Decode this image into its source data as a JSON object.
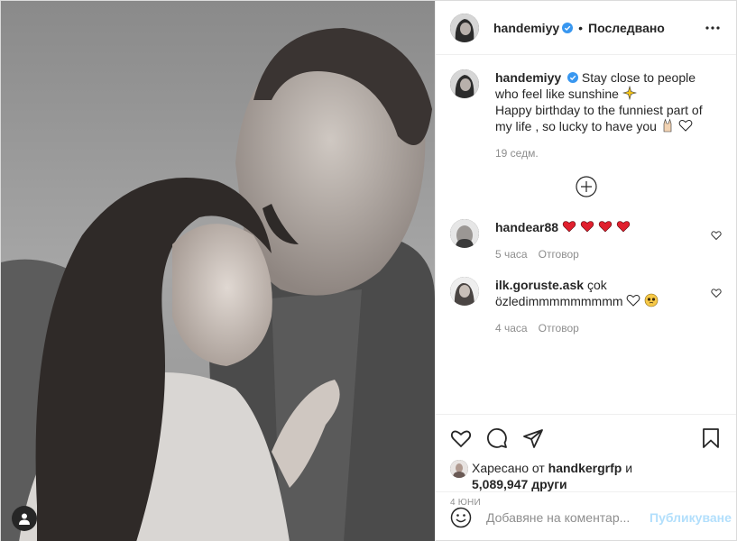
{
  "post": {
    "author": "handemiyy",
    "follow_state": "Последвано",
    "dot": "•",
    "caption_line1": "Stay close to people who feel like sunshine",
    "caption_line2": "Happy birthday to the funniest part of my life , so lucky to have you",
    "caption_time": "19 седм."
  },
  "comments": [
    {
      "user": "handear88",
      "text": "",
      "time": "5 часа",
      "reply": "Отговор"
    },
    {
      "user": "ilk.goruste.ask",
      "text": "çok özledimmmmmmmmm",
      "time": "4 часа",
      "reply": "Отговор"
    }
  ],
  "likes": {
    "prefix": "Харесано от",
    "liker": "handkergrfp",
    "and": "и",
    "count": "5,089,947",
    "suffix": "други"
  },
  "date": "4 юни",
  "add_comment": {
    "placeholder": "Добавяне на коментар...",
    "publish": "Публикуване"
  },
  "icons": {
    "more": "more-horizontal-icon",
    "verified": "verified-badge-icon",
    "like": "heart-icon",
    "comment": "comment-icon",
    "share": "paper-plane-icon",
    "save": "bookmark-icon",
    "emoji": "smiley-icon",
    "load_more": "plus-circle-icon",
    "user_tag": "user-tag-icon"
  },
  "colors": {
    "verified": "#3897f0",
    "heart_red": "#ed4956",
    "publish": "#b2dffc",
    "meta": "#8e8e8e"
  }
}
